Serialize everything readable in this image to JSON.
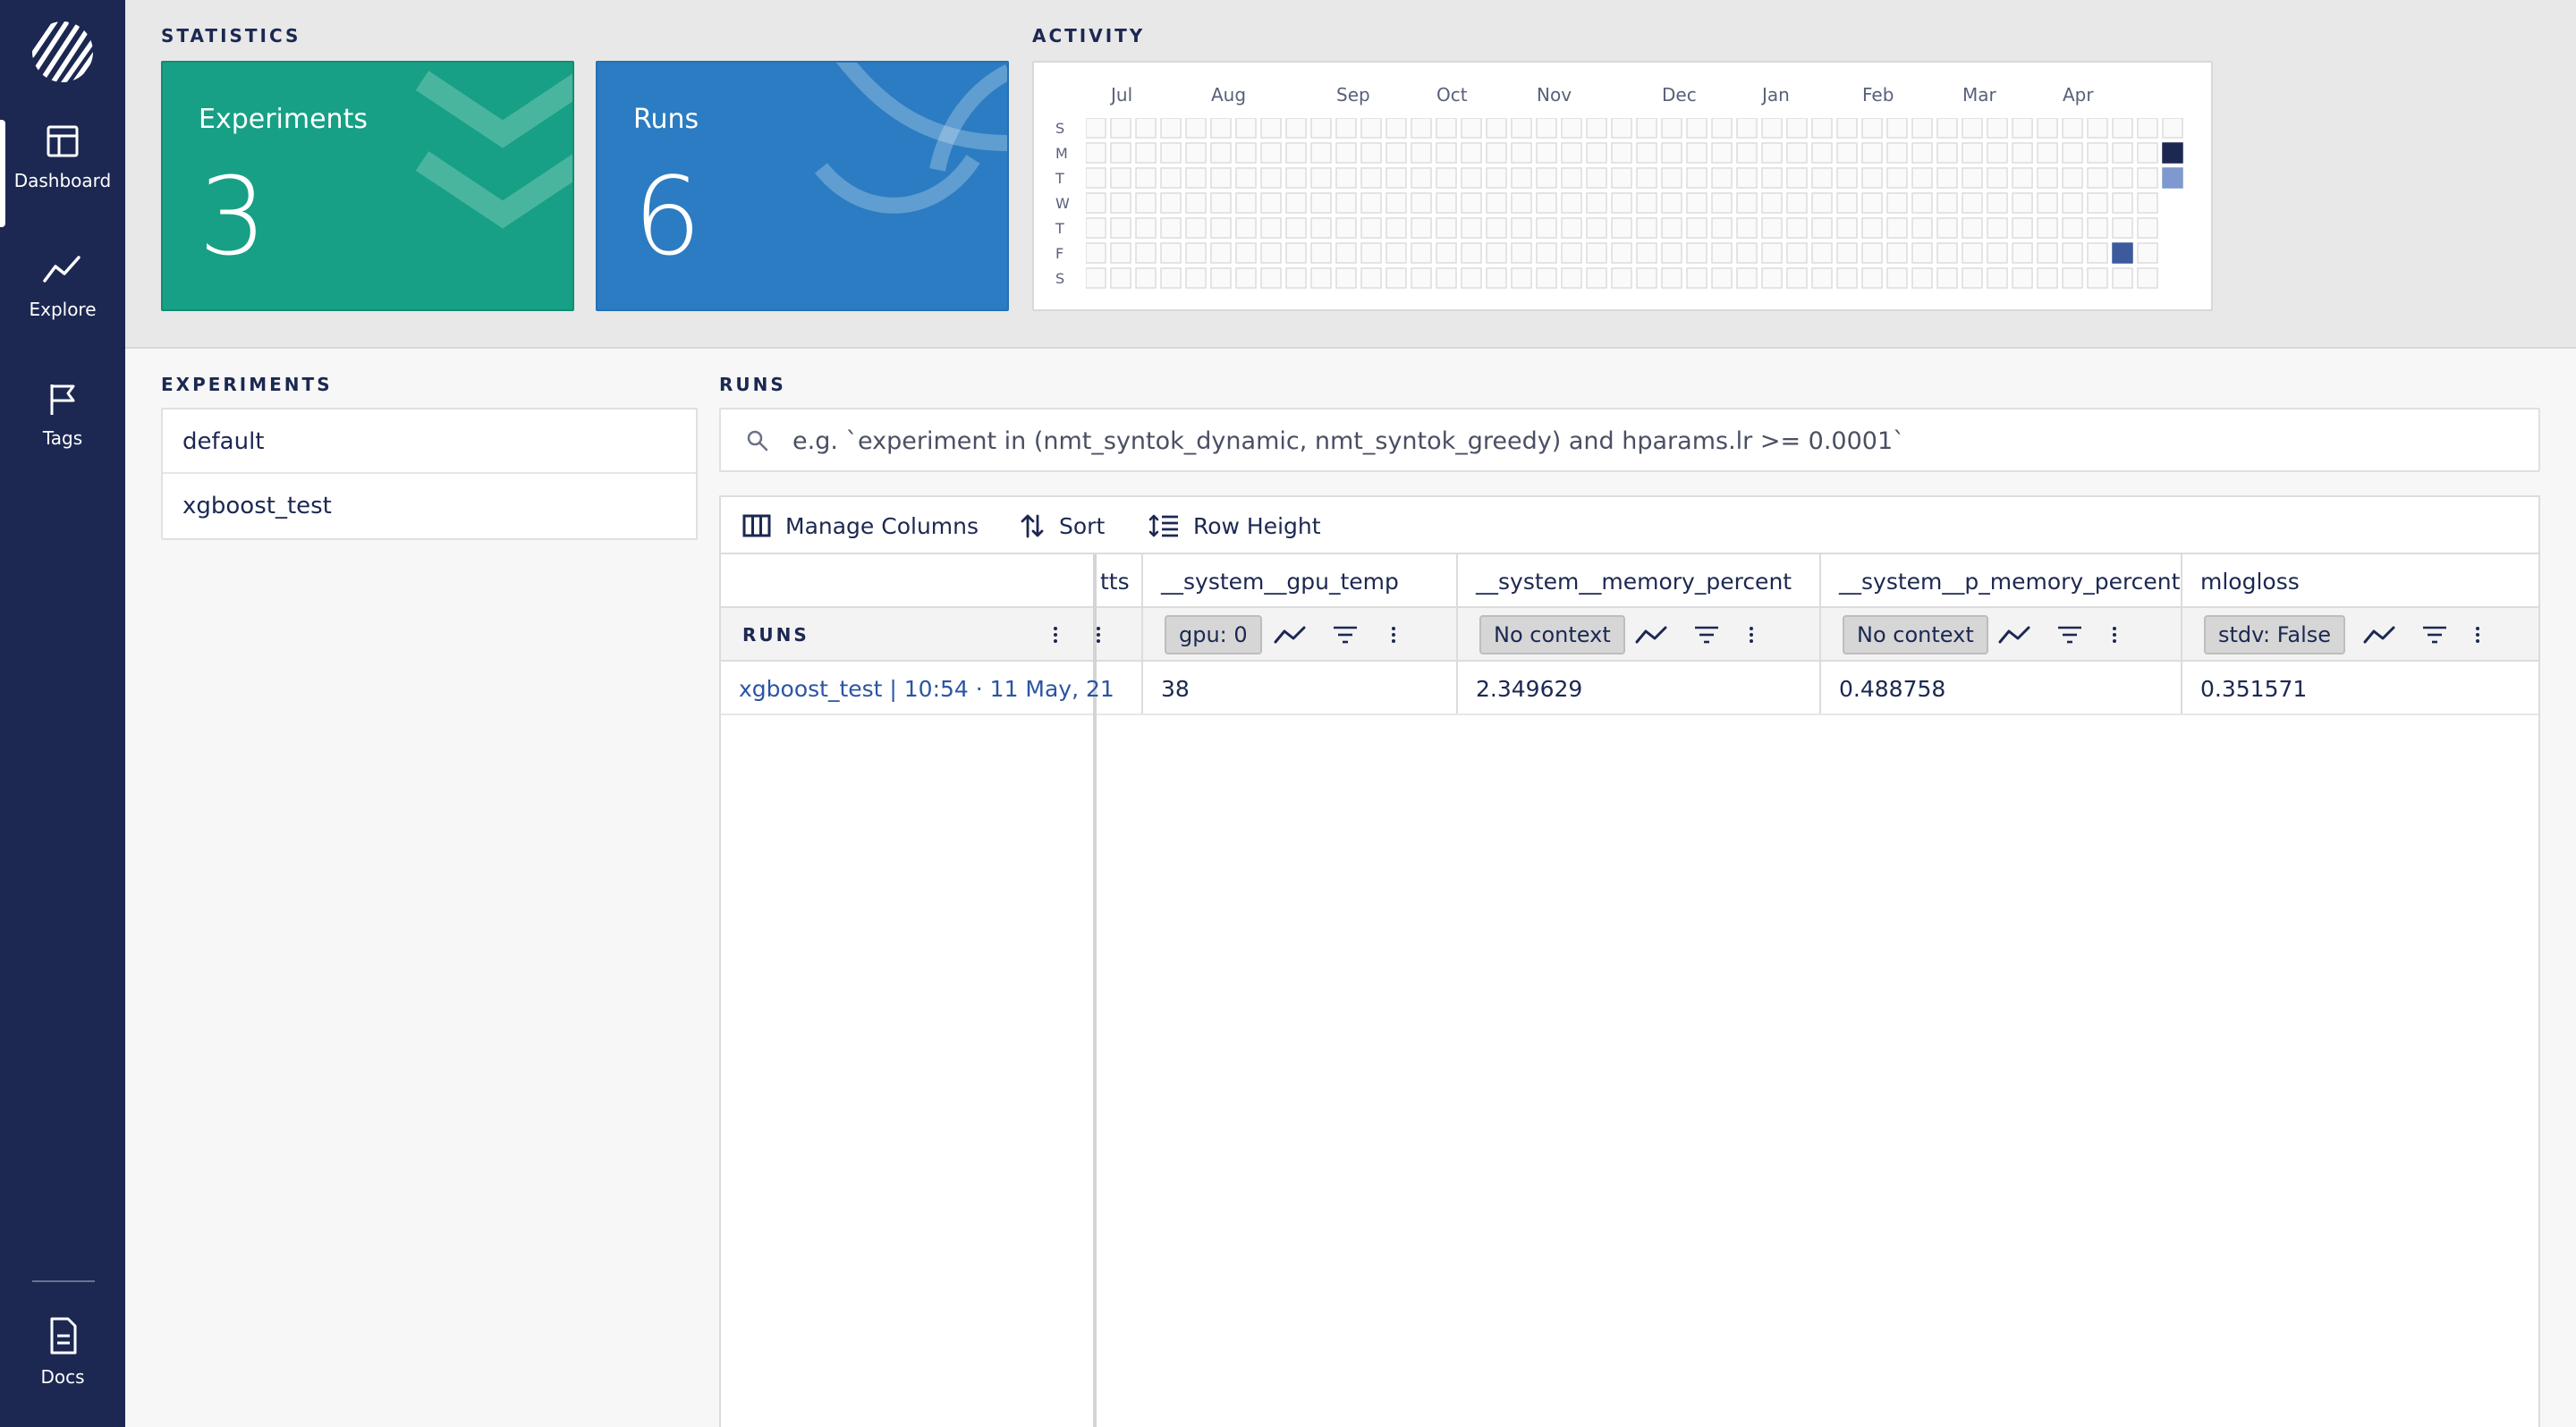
{
  "sidebar": {
    "items": [
      {
        "label": "Dashboard",
        "icon": "dashboard-icon",
        "active": true
      },
      {
        "label": "Explore",
        "icon": "explore-icon",
        "active": false
      },
      {
        "label": "Tags",
        "icon": "flag-icon",
        "active": false
      }
    ],
    "docs_label": "Docs"
  },
  "statistics": {
    "section_label": "STATISTICS",
    "experiments": {
      "title": "Experiments",
      "value": "3"
    },
    "runs": {
      "title": "Runs",
      "value": "6"
    }
  },
  "activity": {
    "section_label": "ACTIVITY",
    "months": [
      "Jul",
      "Aug",
      "Sep",
      "Oct",
      "Nov",
      "Dec",
      "Jan",
      "Feb",
      "Mar",
      "Apr"
    ],
    "days": [
      "S",
      "M",
      "T",
      "W",
      "T",
      "F",
      "S"
    ],
    "active_cells": [
      {
        "week": 43,
        "day": 1,
        "color": "#1c2852"
      },
      {
        "week": 43,
        "day": 2,
        "color": "#7f98cf"
      },
      {
        "week": 41,
        "day": 5,
        "color": "#3d5a9c"
      }
    ]
  },
  "experiments": {
    "section_label": "EXPERIMENTS",
    "items": [
      "default",
      "xgboost_test"
    ]
  },
  "runs": {
    "section_label": "RUNS",
    "search_placeholder": "e.g. `experiment in (nmt_syntok_dynamic, nmt_syntok_greedy) and hparams.lr >= 0.0001`",
    "toolbar": {
      "manage_columns": "Manage Columns",
      "sort": "Sort",
      "row_height": "Row Height"
    },
    "fixed_header": "RUNS",
    "partial_column": "tts",
    "columns": [
      {
        "name": "__system__gpu_temp",
        "context": "gpu: 0",
        "value": "38"
      },
      {
        "name": "__system__memory_percent",
        "context": "No context",
        "value": "2.349629"
      },
      {
        "name": "__system__p_memory_percent",
        "context": "No context",
        "value": "0.488758"
      },
      {
        "name": "mlogloss",
        "context": "stdv: False",
        "value": "0.351571"
      }
    ],
    "rows": [
      {
        "run": "xgboost_test | 10:54 · 11 May, 21"
      }
    ]
  }
}
